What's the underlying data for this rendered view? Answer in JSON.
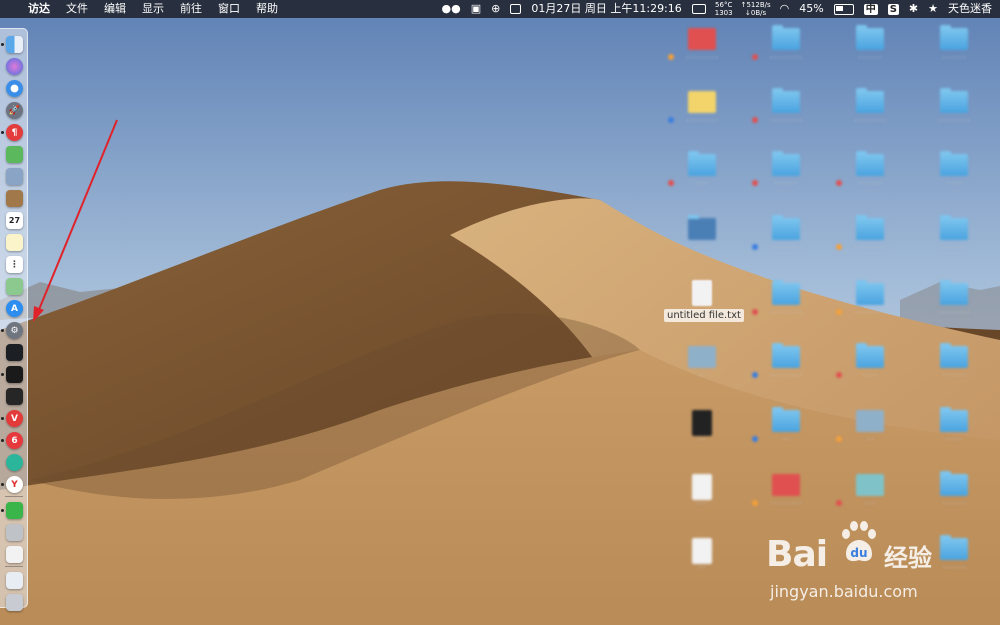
{
  "menubar": {
    "apple": "",
    "app": "访达",
    "items": [
      "文件",
      "编辑",
      "显示",
      "前往",
      "窗口",
      "帮助"
    ],
    "temp": "56°C",
    "fan": "1303",
    "net_up": "↑512B/s",
    "net_down": "↓0B/s",
    "datetime": "01月27日 周日 上午11:29:16",
    "battery": "45%",
    "battery_level": 45,
    "input_method": "中",
    "input_s": "S",
    "user": "天色迷香"
  },
  "desktop": {
    "selected_file_label": "untitled file.txt"
  },
  "watermark": {
    "brand": "Bai",
    "brand2": "经验",
    "url": "jingyan.baidu.com"
  },
  "colors": {
    "menubar_bg": "#242834",
    "arrow": "#e0222a",
    "folder": "#4aa3df"
  },
  "dock_icons": [
    "finder-icon",
    "siri-icon",
    "safari-icon",
    "launchpad-icon",
    "app-red-icon",
    "android-icon",
    "preview-icon",
    "notes-brown-icon",
    "calendar-icon",
    "notes-icon",
    "reminders-icon",
    "maps-icon",
    "app-store-icon",
    "system-preferences-icon",
    "activity-monitor-icon",
    "terminal-icon",
    "terminal2-icon",
    "vivaldi-icon",
    "netease-music-icon",
    "green-app-icon",
    "yandex-icon",
    "wechat-icon",
    "printer-icon",
    "textedit-icon",
    "document-icon",
    "trash-icon"
  ]
}
